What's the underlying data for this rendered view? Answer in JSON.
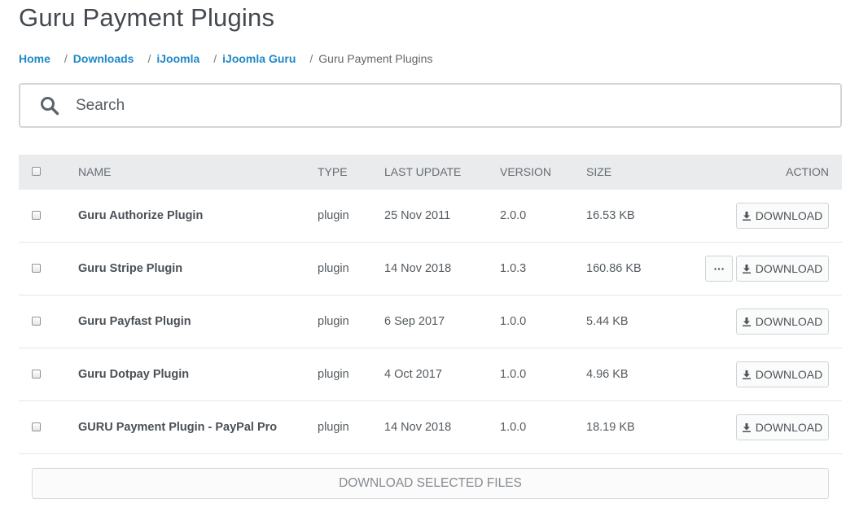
{
  "page": {
    "title": "Guru Payment Plugins"
  },
  "breadcrumb": {
    "items": [
      {
        "label": "Home"
      },
      {
        "label": "Downloads"
      },
      {
        "label": "iJoomla"
      },
      {
        "label": "iJoomla Guru"
      }
    ],
    "separator": "/",
    "current": "Guru Payment Plugins"
  },
  "search": {
    "placeholder": "Search",
    "value": ""
  },
  "table": {
    "headers": {
      "name": "NAME",
      "type": "TYPE",
      "last_update": "LAST UPDATE",
      "version": "VERSION",
      "size": "SIZE",
      "action": "ACTION"
    },
    "rows": [
      {
        "name": "Guru Authorize Plugin",
        "type": "plugin",
        "last_update": "25 Nov 2011",
        "version": "2.0.0",
        "size": "16.53 KB",
        "has_more": false
      },
      {
        "name": "Guru Stripe Plugin",
        "type": "plugin",
        "last_update": "14 Nov 2018",
        "version": "1.0.3",
        "size": "160.86 KB",
        "has_more": true
      },
      {
        "name": "Guru Payfast Plugin",
        "type": "plugin",
        "last_update": "6 Sep 2017",
        "version": "1.0.0",
        "size": "5.44 KB",
        "has_more": false
      },
      {
        "name": "Guru Dotpay Plugin",
        "type": "plugin",
        "last_update": "4 Oct 2017",
        "version": "1.0.0",
        "size": "4.96 KB",
        "has_more": false
      },
      {
        "name": "GURU Payment Plugin - PayPal Pro",
        "type": "plugin",
        "last_update": "14 Nov 2018",
        "version": "1.0.0",
        "size": "18.19 KB",
        "has_more": false
      }
    ],
    "download_label": "DOWNLOAD",
    "more_label": "···"
  },
  "footer": {
    "download_selected_label": "DOWNLOAD SELECTED FILES"
  },
  "icons": {
    "search": "search-icon",
    "download": "download-icon",
    "more": "more-icon"
  },
  "colors": {
    "link": "#1e88c7",
    "title": "#444a4f",
    "header_bg": "#e9ebed",
    "border": "#d2d6d9"
  }
}
